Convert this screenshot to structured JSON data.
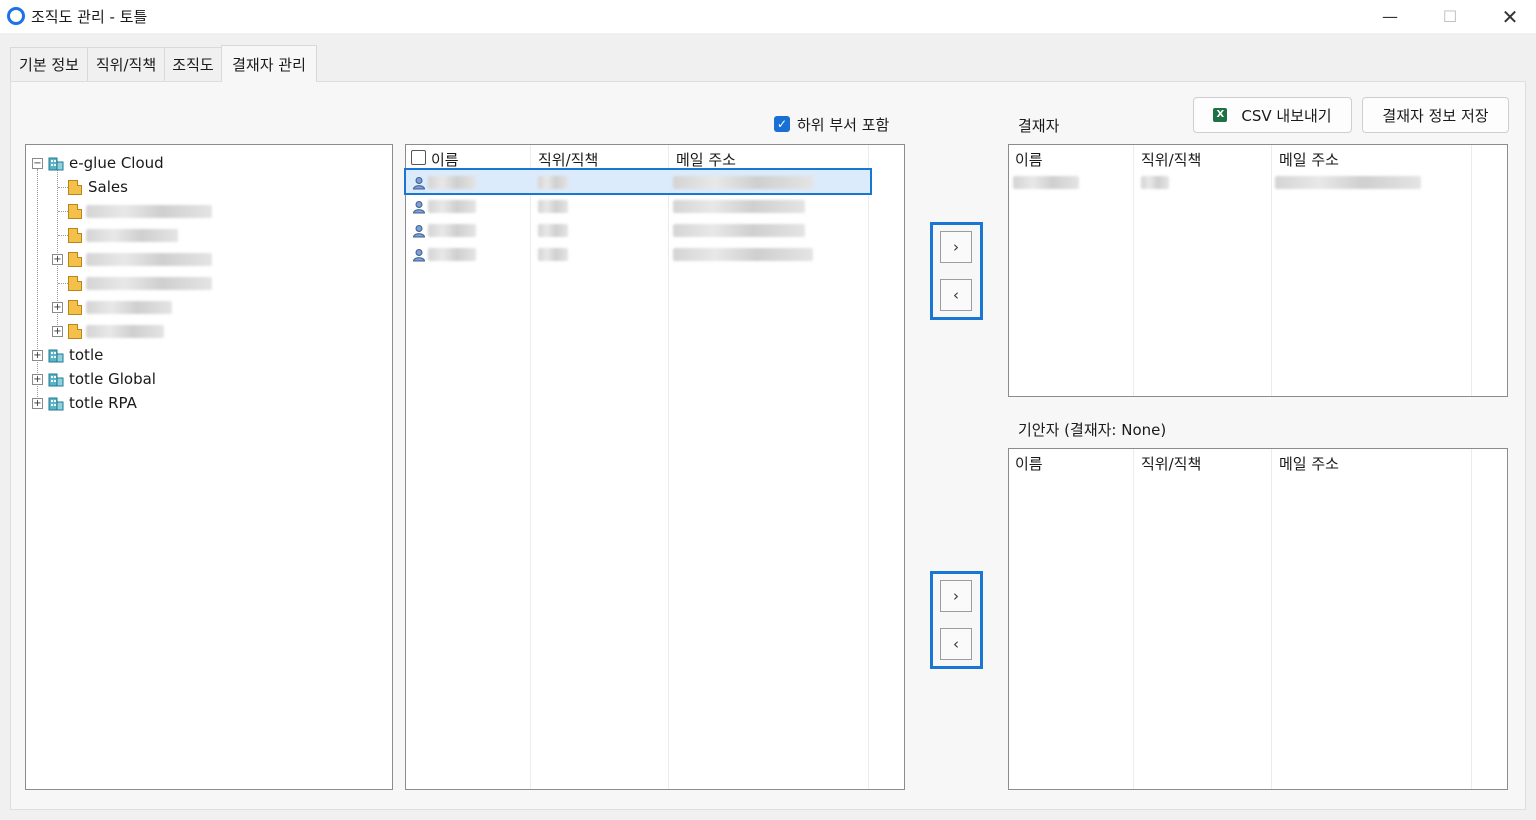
{
  "window": {
    "title": "조직도 관리 - 토틀",
    "minimize": "—",
    "maximize": "☐",
    "close": "✕"
  },
  "tabs": [
    {
      "label": "기본 정보"
    },
    {
      "label": "직위/직책"
    },
    {
      "label": "조직도"
    },
    {
      "label": "결재자 관리",
      "active": true
    }
  ],
  "include_sub": {
    "label": "하위 부서 포함",
    "checked": true
  },
  "tree": {
    "root": "e-glue Cloud",
    "selected_child": "Sales",
    "other_roots": [
      "totle",
      "totle Global",
      "totle RPA"
    ]
  },
  "user_list": {
    "columns": [
      "이름",
      "직위/직책",
      "메일 주소"
    ],
    "row_count": 4
  },
  "buttons": {
    "csv": "CSV 내보내기",
    "save": "결재자 정보 저장",
    "move_right": "›",
    "move_left": "‹"
  },
  "approver": {
    "label": "결재자",
    "columns": [
      "이름",
      "직위/직책",
      "메일 주소"
    ]
  },
  "drafter": {
    "label": "기안자 (결재자: None)",
    "columns": [
      "이름",
      "직위/직책",
      "메일 주소"
    ]
  },
  "colors": {
    "accent": "#1976d2",
    "folder": "#f5c04a",
    "excel": "#1e7145"
  }
}
